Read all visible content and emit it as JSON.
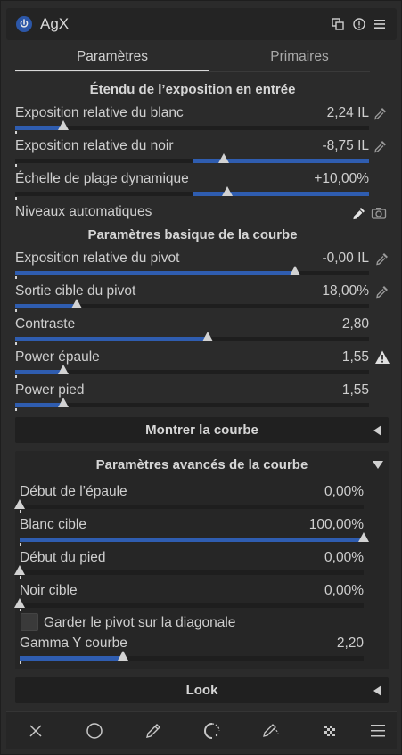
{
  "header": {
    "module_name": "AgX",
    "icons": [
      "power-icon",
      "multi-instance-icon",
      "reset-icon",
      "presets-icon"
    ]
  },
  "tabs": [
    {
      "label": "Paramètres",
      "active": true
    },
    {
      "label": "Primaires",
      "active": false
    }
  ],
  "sections": {
    "exposure": "Étendu de l’exposition en entrée",
    "curve_basic": "Paramètres basique de la courbe"
  },
  "sliders_exposure": [
    {
      "label": "Exposition relative du blanc",
      "value": "2,24 IL",
      "level": 0.135,
      "picker": true
    },
    {
      "label": "Exposition relative du noir",
      "value": "-8,75 IL",
      "level": 0.59,
      "fill_from_center": true,
      "picker": true
    },
    {
      "label": "Échelle de plage dynamique",
      "value": "+10,00%",
      "level": 0.6,
      "fill_from_center": true,
      "picker": false
    }
  ],
  "auto_levels": {
    "label": "Niveaux automatiques",
    "icons": [
      "color-picker-icon",
      "camera-icon"
    ]
  },
  "sliders_curve": [
    {
      "label": "Exposition relative du pivot",
      "value": "-0,00 IL",
      "level": 0.79,
      "picker": true
    },
    {
      "label": "Sortie cible du pivot",
      "value": "18,00%",
      "level": 0.175,
      "picker": true
    },
    {
      "label": "Contraste",
      "value": "2,80",
      "level": 0.545,
      "picker": false
    },
    {
      "label": "Power épaule",
      "value": "1,55",
      "level": 0.135,
      "picker": false,
      "warning": true
    },
    {
      "label": "Power pied",
      "value": "1,55",
      "level": 0.135,
      "picker": false
    }
  ],
  "show_curve": {
    "label": "Montrer la courbe"
  },
  "advanced": {
    "title": "Paramètres avancés de la courbe",
    "sliders": [
      {
        "label": "Début de l’épaule",
        "value": "0,00%",
        "level": 0.0
      },
      {
        "label": "Blanc cible",
        "value": "100,00%",
        "level": 1.0
      },
      {
        "label": "Début du pied",
        "value": "0,00%",
        "level": 0.0
      },
      {
        "label": "Noir cible",
        "value": "0,00%",
        "level": 0.0
      }
    ],
    "checkbox": {
      "label": "Garder le pivot sur la diagonale",
      "checked": false
    },
    "gamma": {
      "label": "Gamma Y courbe",
      "value": "2,20",
      "level": 0.3
    }
  },
  "look": {
    "label": "Look"
  },
  "toolbar_icons": [
    "close-icon",
    "circle-mask-icon",
    "drawn-mask-icon",
    "parametric-mask-icon",
    "drawn-parametric-mask-icon",
    "raster-mask-icon",
    "blend-options-icon"
  ],
  "colors": {
    "accent": "#2f5db0",
    "power": "#2c57a8"
  }
}
